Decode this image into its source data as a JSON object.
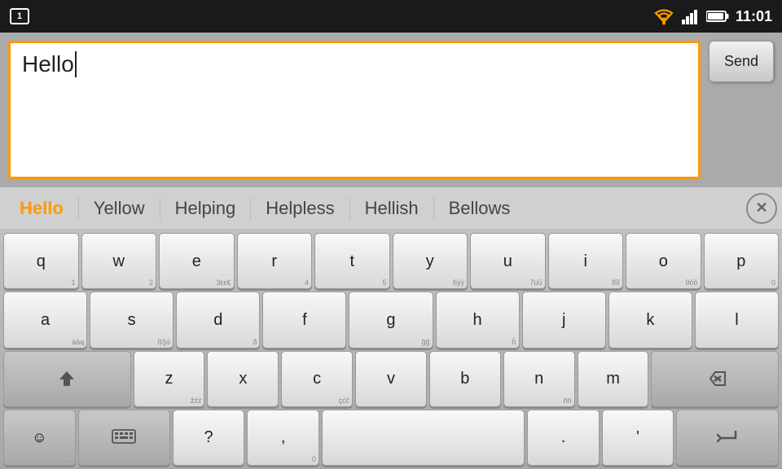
{
  "statusBar": {
    "notif": "1",
    "time": "11:01"
  },
  "messageArea": {
    "inputText": "Hello",
    "sendLabel": "Send"
  },
  "suggestions": [
    {
      "id": "s1",
      "label": "Hello",
      "active": true
    },
    {
      "id": "s2",
      "label": "Yellow",
      "active": false
    },
    {
      "id": "s3",
      "label": "Helping",
      "active": false
    },
    {
      "id": "s4",
      "label": "Helpless",
      "active": false
    },
    {
      "id": "s5",
      "label": "Hellish",
      "active": false
    },
    {
      "id": "s6",
      "label": "Bellows",
      "active": false
    }
  ],
  "keyboard": {
    "rows": [
      [
        {
          "main": "q",
          "sub": "1"
        },
        {
          "main": "w",
          "sub": "2"
        },
        {
          "main": "e",
          "sub": "3εε€"
        },
        {
          "main": "r",
          "sub": "4"
        },
        {
          "main": "t",
          "sub": "5"
        },
        {
          "main": "y",
          "sub": "6ÿý"
        },
        {
          "main": "u",
          "sub": "7üū"
        },
        {
          "main": "i",
          "sub": "8īï"
        },
        {
          "main": "o",
          "sub": "9öō"
        },
        {
          "main": "p",
          "sub": "0"
        }
      ],
      [
        {
          "main": "a",
          "sub": "àāą"
        },
        {
          "main": "s",
          "sub": "ßŞś"
        },
        {
          "main": "d",
          "sub": "ð"
        },
        {
          "main": "f",
          "sub": ""
        },
        {
          "main": "g",
          "sub": "ğĝ"
        },
        {
          "main": "h",
          "sub": "ĥ"
        },
        {
          "main": "j",
          "sub": ""
        },
        {
          "main": "k",
          "sub": ""
        },
        {
          "main": "l",
          "sub": ""
        }
      ],
      [
        {
          "main": "shift",
          "special": true
        },
        {
          "main": "z",
          "sub": "žźż"
        },
        {
          "main": "x",
          "sub": ""
        },
        {
          "main": "c",
          "sub": "çćč"
        },
        {
          "main": "v",
          "sub": ""
        },
        {
          "main": "b",
          "sub": ""
        },
        {
          "main": "n",
          "sub": "ñń"
        },
        {
          "main": "m",
          "sub": ""
        },
        {
          "main": "backspace",
          "special": true
        }
      ],
      [
        {
          "main": "emoji",
          "special": true
        },
        {
          "main": "keyboard",
          "special": true
        },
        {
          "main": "?",
          "sub": ""
        },
        {
          "main": ",",
          "sub": "0"
        },
        {
          "main": "space",
          "special": true
        },
        {
          "main": ".",
          "sub": ""
        },
        {
          "main": "'",
          "sub": ""
        },
        {
          "main": "enter",
          "special": true
        }
      ]
    ]
  }
}
